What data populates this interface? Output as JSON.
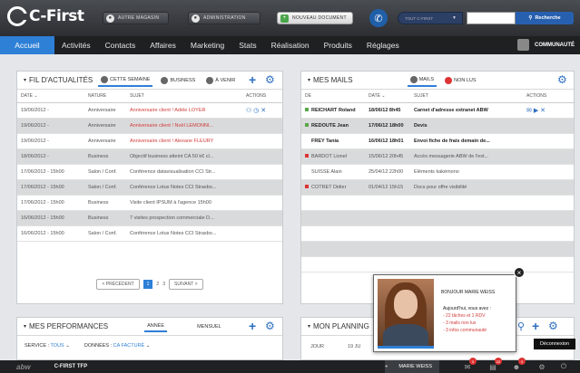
{
  "header": {
    "logo": "C-First",
    "buttons": [
      "AUTRE MAGASIN",
      "ADMINISTRATION"
    ],
    "new_doc": "NOUVEAU DOCUMENT",
    "search_scope": "TOUT C-FIRST",
    "search_btn": "Recherche"
  },
  "nav": {
    "tabs": [
      "Accueil",
      "Activités",
      "Contacts",
      "Affaires",
      "Marketing",
      "Stats",
      "Réalisation",
      "Produits",
      "Réglages"
    ],
    "community": "COMMUNAUTÉ"
  },
  "feed": {
    "title": "FIL D'ACTUALITÉS",
    "filters": [
      "CETTE SEMAINE",
      "BUSINESS",
      "À VENIR"
    ],
    "headers": [
      "DATE",
      "NATURE",
      "SUJET",
      "ACTIONS"
    ],
    "rows": [
      {
        "date": "19/06/2012 -",
        "nature": "Anniversaire",
        "subject": "Anniversaire client ! Adèle LOYER"
      },
      {
        "date": "19/06/2012 -",
        "nature": "Anniversaire",
        "subject": "Anniversaire client ! Noël LEMONNI..."
      },
      {
        "date": "19/06/2012 -",
        "nature": "Anniversaire",
        "subject": "Anniversaire client ! Alexane FLEURY"
      },
      {
        "date": "18/06/2012 -",
        "nature": "Business",
        "subject": "Objectif business atteint CA 50 k€ cl..."
      },
      {
        "date": "17/06/2012 - 15h00",
        "nature": "Salon / Conf.",
        "subject": "Conférence datavisualisation CCI Str..."
      },
      {
        "date": "17/06/2012 - 15h00",
        "nature": "Salon / Conf.",
        "subject": "Conférence Lotus Notes CCI Strasbo..."
      },
      {
        "date": "17/06/2012 - 15h00",
        "nature": "Business",
        "subject": "Visite client IPSUM à l'agence 15h00"
      },
      {
        "date": "16/06/2012 - 15h00",
        "nature": "Business",
        "subject": "7 visites prospection commerciale D..."
      },
      {
        "date": "16/06/2012 - 15h00",
        "nature": "Salon / Conf.",
        "subject": "Conférence Lotus Notes CCI Strasbo..."
      }
    ],
    "pager": {
      "prev": "< PRÉCÉDENT",
      "pages": [
        "1",
        "2",
        "3"
      ],
      "next": "SUIVANT >"
    }
  },
  "mails": {
    "title": "MES MAILS",
    "filters": [
      "MAILS",
      "NON LUS"
    ],
    "headers": [
      "DE",
      "DATE",
      "SUJET",
      "ACTIONS"
    ],
    "rows": [
      {
        "from": "REICHART Roland",
        "date": "18/06/12 8h45",
        "subject": "Carnet d'adresse extranet ABW",
        "color": "#5aa64a"
      },
      {
        "from": "REDOUTE Jean",
        "date": "17/06/12 18h00",
        "subject": "Devis",
        "color": "#5aa64a"
      },
      {
        "from": "FREY Tania",
        "date": "16/06/12 18h01",
        "subject": "Envoi fiche de frais demain de...",
        "color": ""
      },
      {
        "from": "BARDOT Lionel",
        "date": "15/06/12 20h45",
        "subject": "Accès messagerie ABW de l'ext...",
        "color": "#d33"
      },
      {
        "from": "SUISSE Alain",
        "date": "25/04/12 22h00",
        "subject": "Eléments kakémono",
        "color": ""
      },
      {
        "from": "COTRET Didier",
        "date": "01/04/12 15h15",
        "subject": "Docs pour offre visibilité",
        "color": "#d33"
      }
    ]
  },
  "perf": {
    "title": "MES PERFORMANCES",
    "tabs": [
      "ANNÉE",
      "MENSUEL"
    ],
    "service_label": "SERVICE :",
    "service_value": "TOUS",
    "data_label": "DONNÉES :",
    "data_value": "CA FACTURÉ"
  },
  "planning": {
    "title": "MON PLANNING",
    "col_day": "JOUR",
    "col_date": "19 JU"
  },
  "popup": {
    "greeting": "BONJOUR MARIE WEISS",
    "lead": "Aujourd'hui, vous avez :",
    "items": [
      "- 22 tâches et 1 RDV",
      "- 3 mails non lus",
      "- 3 infos communauté"
    ]
  },
  "tooltip": "Déconnexion",
  "bottom": {
    "brand": "abw",
    "app": "C-FIRST TFP",
    "user": "MARIE WEISS",
    "badges": [
      "3",
      "22",
      "3"
    ]
  }
}
